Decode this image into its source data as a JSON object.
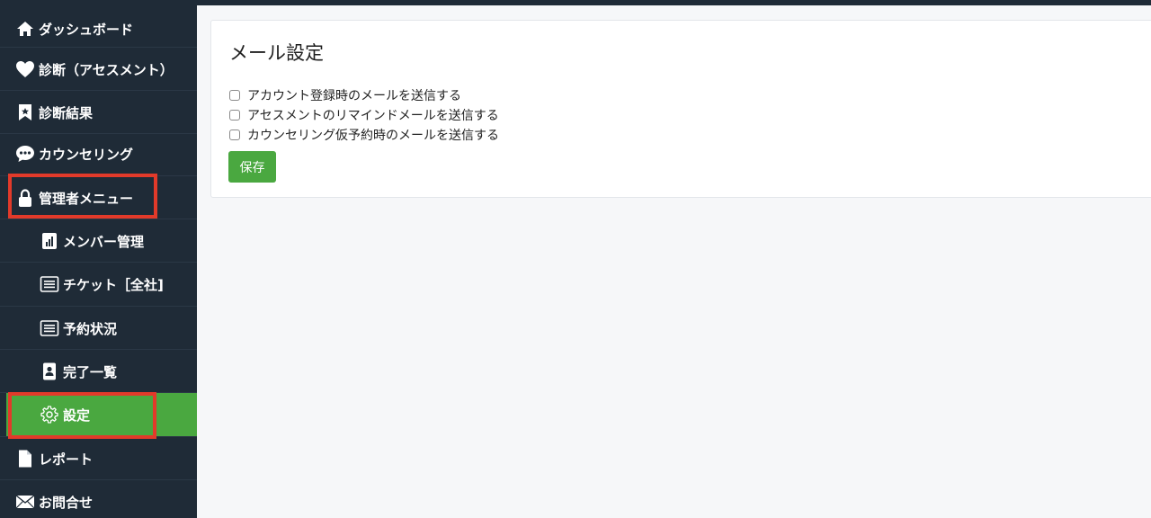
{
  "sidebar": {
    "items": [
      {
        "label": "ダッシュボード",
        "icon": "home-icon"
      },
      {
        "label": "診断（アセスメント）",
        "icon": "heart-icon"
      },
      {
        "label": "診断結果",
        "icon": "bookmark-icon"
      },
      {
        "label": "カウンセリング",
        "icon": "chat-bubble-icon"
      },
      {
        "label": "管理者メニュー",
        "icon": "lock-icon"
      },
      {
        "label": "メンバー管理",
        "icon": "bar-chart-icon"
      },
      {
        "label": "チケット［全社]",
        "icon": "list-icon"
      },
      {
        "label": "予約状況",
        "icon": "list-icon"
      },
      {
        "label": "完了一覧",
        "icon": "id-card-icon"
      },
      {
        "label": "設定",
        "icon": "gear-icon"
      },
      {
        "label": "レポート",
        "icon": "document-icon"
      },
      {
        "label": "お問合せ",
        "icon": "mail-icon"
      }
    ],
    "active_index": 9
  },
  "card": {
    "title": "メール設定",
    "checkboxes": [
      {
        "label": "アカウント登録時のメールを送信する",
        "checked": false
      },
      {
        "label": "アセスメントのリマインドメールを送信する",
        "checked": false
      },
      {
        "label": "カウンセリング仮予約時のメールを送信する",
        "checked": false
      }
    ],
    "save_label": "保存"
  },
  "colors": {
    "sidebar_bg": "#1f2b37",
    "accent_green": "#4aa840",
    "highlight_red": "#e23a2a"
  }
}
